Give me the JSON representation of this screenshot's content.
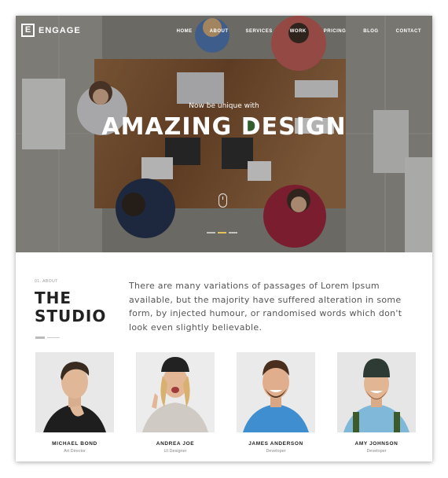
{
  "brand": {
    "logo_letter": "E",
    "name": "ENGAGE"
  },
  "nav": [
    "HOME",
    "ABOUT",
    "SERVICES",
    "WORK",
    "PRICING",
    "BLOG",
    "CONTACT"
  ],
  "hero": {
    "subtitle": "Now be unique with",
    "title": "AMAZING DESIGN",
    "slides": 3,
    "active_slide": 2
  },
  "about": {
    "eyebrow": "01. ABOUT",
    "title_line1": "THE",
    "title_line2": "STUDIO",
    "text": "There are many variations of passages of Lorem Ipsum available, but the majority have suffered alteration in some form, by injected humour, or randomised words which don't look even slightly believable."
  },
  "team": [
    {
      "name": "MICHAEL BOND",
      "role": "Art Director"
    },
    {
      "name": "ANDREA JOE",
      "role": "UI Designer"
    },
    {
      "name": "JAMES ANDERSON",
      "role": "Developer"
    },
    {
      "name": "AMY JOHNSON",
      "role": "Developer"
    }
  ],
  "colors": {
    "accent": "#e2c25d",
    "text_dark": "#222222",
    "text_body": "#555555"
  }
}
